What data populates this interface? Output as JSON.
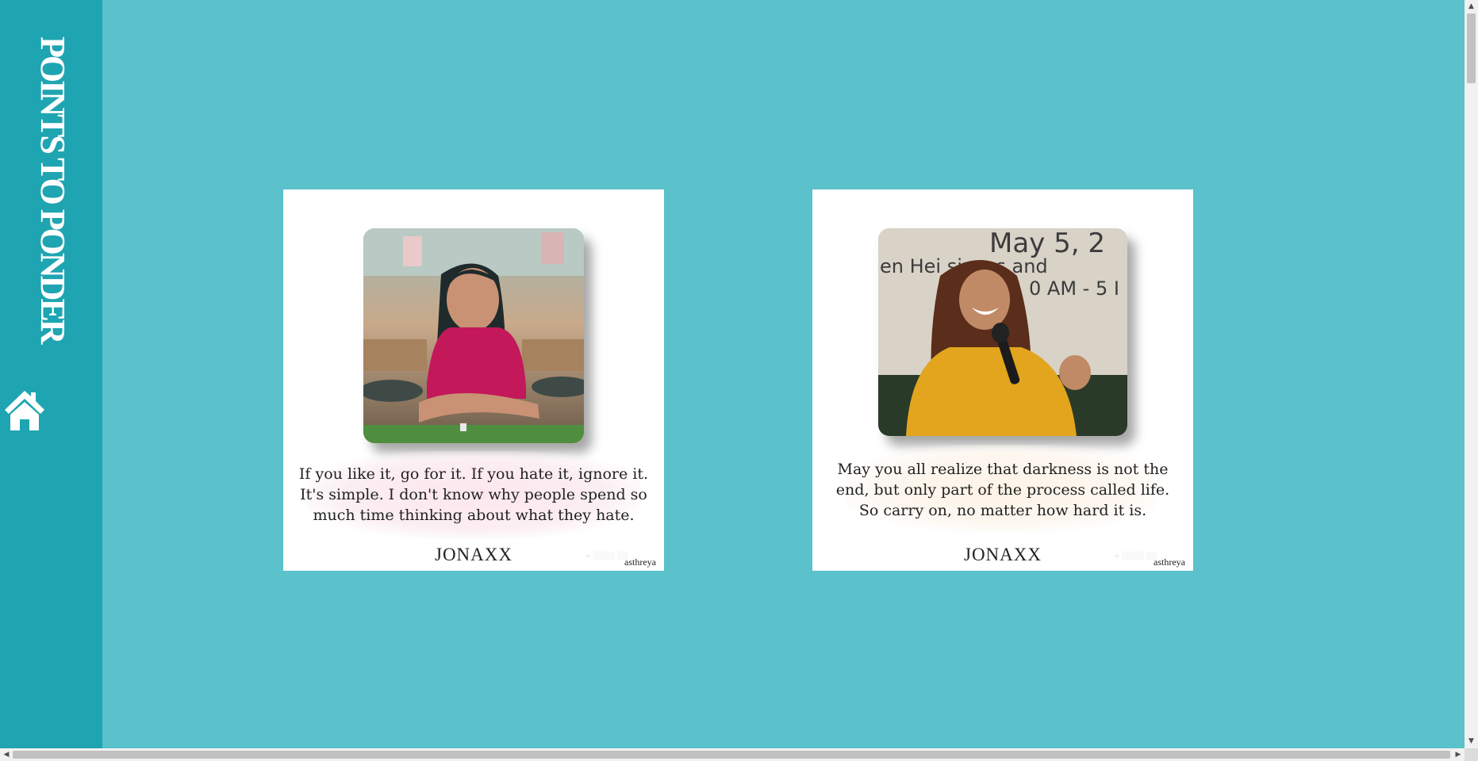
{
  "sidebar": {
    "title": "POINTS TO PONDER",
    "home_icon": "home-icon"
  },
  "colors": {
    "page_background": "#5bc1cb",
    "sidebar_background": "#1ea5b1",
    "card_background": "#ffffff"
  },
  "posts": [
    {
      "quote_lines": [
        "If you like it, go for it. If you hate it, ignore it.",
        "It's simple. I don't know why people spend so",
        "much time thinking about what they hate."
      ],
      "author": "JONAXX",
      "credit": "asthreya",
      "photo_description": "woman in magenta top smiling at a cafe table"
    },
    {
      "quote_lines": [
        "May you all realize that darkness is not the",
        "end, but only part of the process called life.",
        "So carry on, no matter how hard it is."
      ],
      "author": "JONAXX",
      "credit": "asthreya",
      "photo_description": "woman in yellow top laughing while holding a microphone",
      "photo_banner_lines": [
        "May 5, 2",
        "en Hei   siness and",
        "0 AM - 5 I"
      ]
    }
  ]
}
